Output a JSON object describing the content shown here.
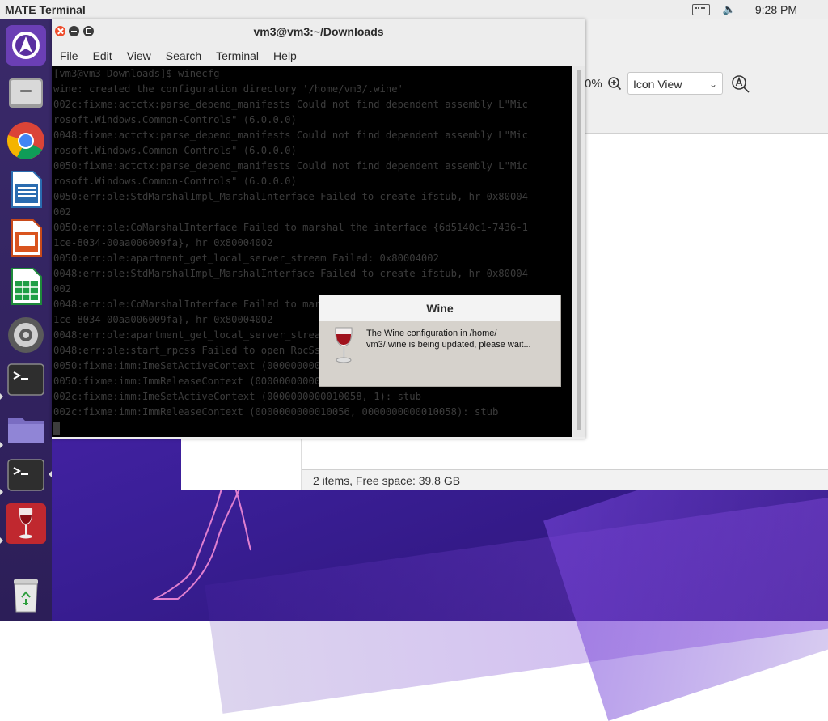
{
  "top_panel": {
    "app_name": "MATE Terminal",
    "clock": "9:28 PM",
    "icons": [
      "keyboard-icon",
      "volume-icon"
    ]
  },
  "launcher": {
    "items": [
      {
        "name": "launcher-app-icon",
        "icon": "ubuntu-mate-logo-icon"
      },
      {
        "name": "files",
        "icon": "file-cabinet-icon"
      },
      {
        "name": "chrome",
        "icon": "chrome-icon"
      },
      {
        "name": "writer",
        "icon": "libreoffice-writer-icon"
      },
      {
        "name": "impress",
        "icon": "libreoffice-impress-icon"
      },
      {
        "name": "calc",
        "icon": "libreoffice-calc-icon"
      },
      {
        "name": "settings",
        "icon": "settings-gear-icon"
      },
      {
        "name": "terminal",
        "icon": "terminal-icon"
      },
      {
        "name": "folder",
        "icon": "folder-icon"
      },
      {
        "name": "terminal2",
        "icon": "terminal-icon"
      },
      {
        "name": "wine",
        "icon": "wine-glass-icon"
      },
      {
        "name": "trash",
        "icon": "trash-icon"
      }
    ]
  },
  "file_manager": {
    "zoom_text": "0%",
    "view_mode": "Icon View",
    "status": "2 items, Free space: 39.8 GB"
  },
  "terminal": {
    "title": "vm3@vm3:~/Downloads",
    "menu": [
      "File",
      "Edit",
      "View",
      "Search",
      "Terminal",
      "Help"
    ],
    "lines": [
      "[vm3@vm3 Downloads]$ winecfg",
      "wine: created the configuration directory '/home/vm3/.wine'",
      "002c:fixme:actctx:parse_depend_manifests Could not find dependent assembly L\"Mic",
      "rosoft.Windows.Common-Controls\" (6.0.0.0)",
      "0048:fixme:actctx:parse_depend_manifests Could not find dependent assembly L\"Mic",
      "rosoft.Windows.Common-Controls\" (6.0.0.0)",
      "0050:fixme:actctx:parse_depend_manifests Could not find dependent assembly L\"Mic",
      "rosoft.Windows.Common-Controls\" (6.0.0.0)",
      "0050:err:ole:StdMarshalImpl_MarshalInterface Failed to create ifstub, hr 0x80004",
      "002",
      "0050:err:ole:CoMarshalInterface Failed to marshal the interface {6d5140c1-7436-1",
      "1ce-8034-00aa006009fa}, hr 0x80004002",
      "0050:err:ole:apartment_get_local_server_stream Failed: 0x80004002",
      "0048:err:ole:StdMarshalImpl_MarshalInterface Failed to create ifstub, hr 0x80004",
      "002",
      "0048:err:ole:CoMarshalInterface Failed to marshal the interface {6d5140c1-7436-1",
      "1ce-8034-00aa006009fa}, hr 0x80004002",
      "0048:err:ole:apartment_get_local_server_stream Failed: 0x80004002",
      "0048:err:ole:start_rpcss Failed to open RpcSs service",
      "0050:fixme:imm:ImeSetActiveContext (0000000000010056, 1): stub",
      "0050:fixme:imm:ImmReleaseContext (0000000000010056, 0000000000010058): stub",
      "002c:fixme:imm:ImeSetActiveContext (0000000000010058, 1): stub",
      "002c:fixme:imm:ImmReleaseContext (0000000000010056, 0000000000010058): stub"
    ]
  },
  "wine_dialog": {
    "title": "Wine",
    "message_line1": "The Wine configuration in /home/",
    "message_line2": "vm3/.wine is being updated, please wait..."
  }
}
